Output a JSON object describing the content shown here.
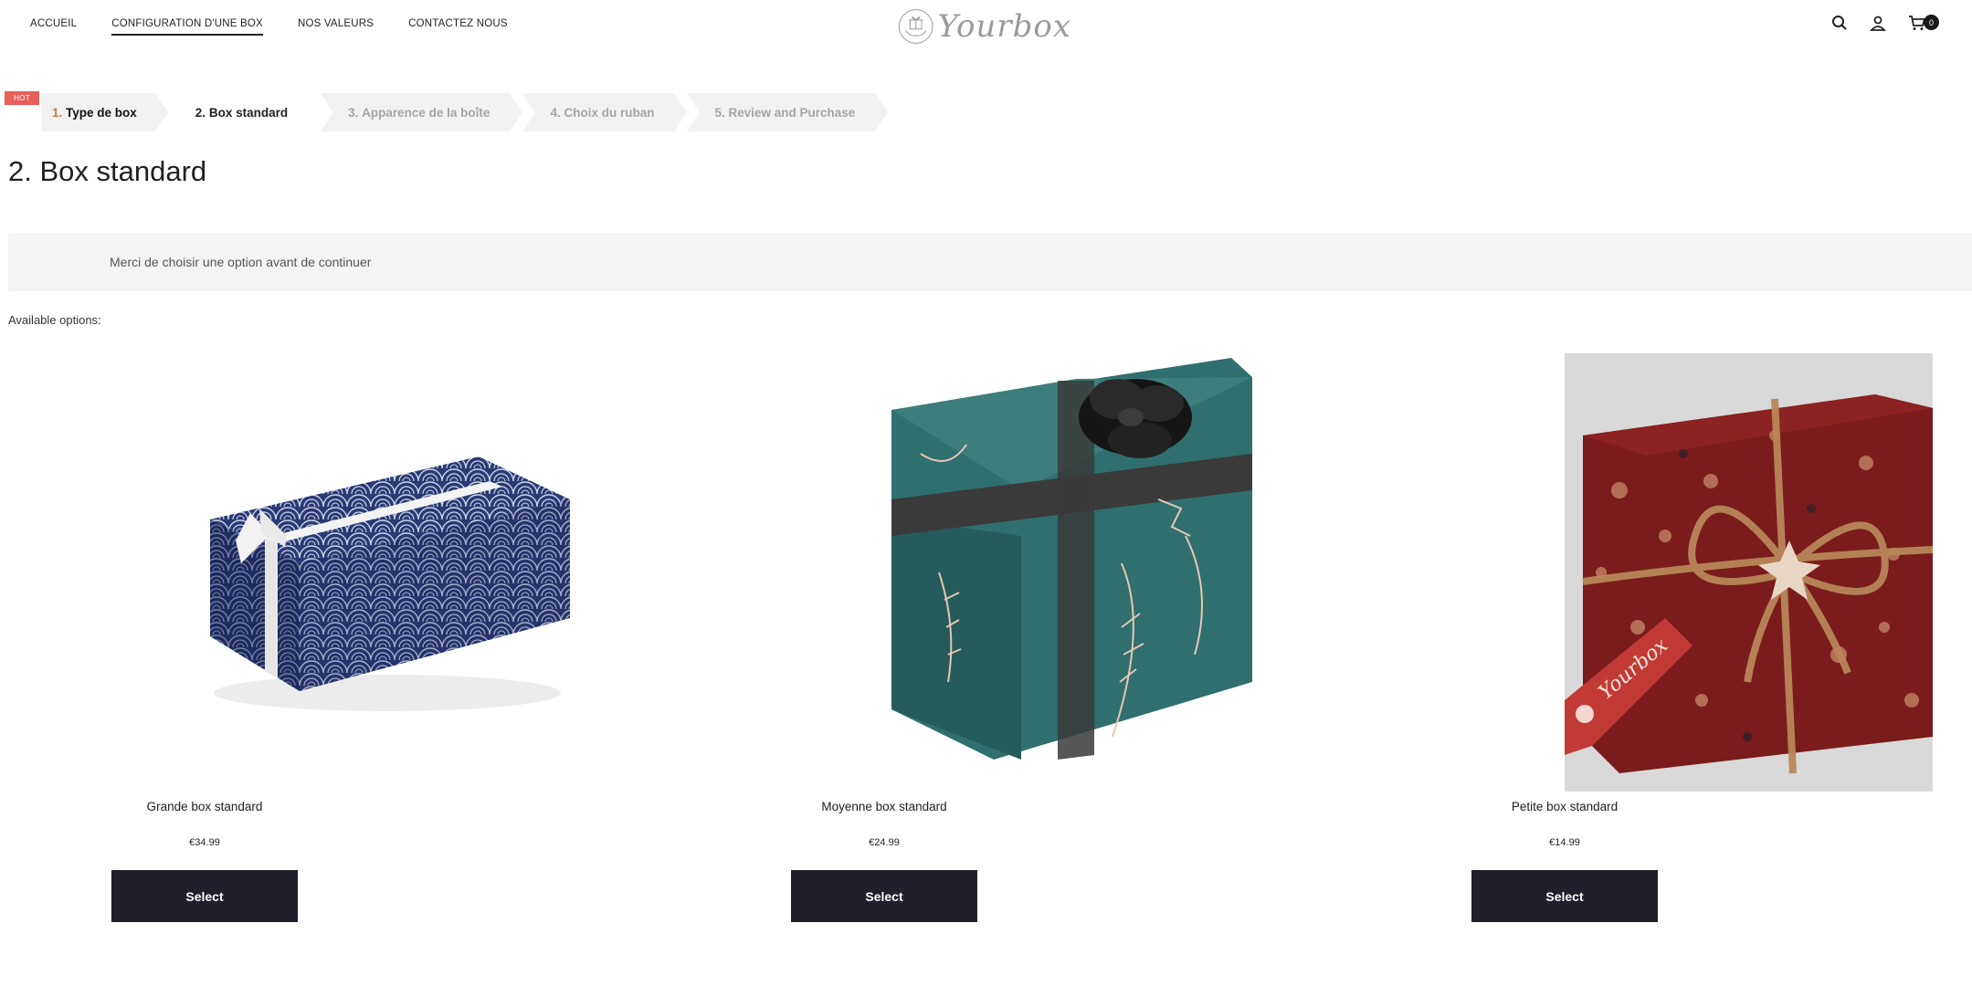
{
  "nav": {
    "items": [
      {
        "label": "ACCUEIL"
      },
      {
        "label": "CONFIGURATION D'UNE BOX"
      },
      {
        "label": "NOS VALEURS"
      },
      {
        "label": "CONTACTEZ NOUS"
      }
    ]
  },
  "brand": {
    "name": "Yourbox"
  },
  "header": {
    "icons": [
      "search-icon",
      "user-icon",
      "cart-icon"
    ],
    "cart_count": "0"
  },
  "badge": {
    "label": "HOT"
  },
  "steps": [
    {
      "number": "1.",
      "label": "Type de box"
    },
    {
      "number": "2.",
      "label": "Box standard"
    },
    {
      "number": "3.",
      "label": "Apparence de la boîte"
    },
    {
      "number": "4.",
      "label": "Choix du ruban"
    },
    {
      "number": "5.",
      "label": "Review and Purchase"
    }
  ],
  "page": {
    "title": "2. Box standard",
    "notice": "Merci de choisir une option avant de continuer",
    "available_label": "Available options:"
  },
  "products": [
    {
      "name": "Grande box standard",
      "price": "€34.99",
      "button": "Select"
    },
    {
      "name": "Moyenne box standard",
      "price": "€24.99",
      "button": "Select"
    },
    {
      "name": "Petite box standard",
      "price": "€14.99",
      "button": "Select"
    }
  ],
  "colors": {
    "accent": "#e8605a",
    "button": "#1f2029",
    "step_done_number": "#c77f43",
    "notice_bg": "#f4f4f4"
  }
}
